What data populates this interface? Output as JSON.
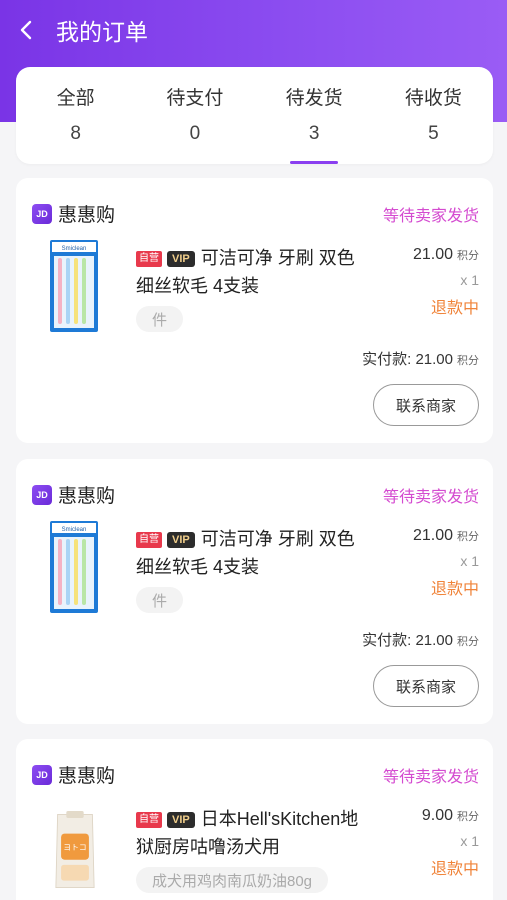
{
  "header": {
    "title": "我的订单",
    "back_icon": "chevron-left-icon"
  },
  "tabs": [
    {
      "label": "全部",
      "count": "8"
    },
    {
      "label": "待支付",
      "count": "0"
    },
    {
      "label": "待发货",
      "count": "3"
    },
    {
      "label": "待收货",
      "count": "5"
    }
  ],
  "active_tab": "待发货",
  "colors": {
    "accent": "#8a3ff0",
    "status": "#d44bd0",
    "refund": "#f0843a"
  },
  "orders": [
    {
      "shop": {
        "icon_text": "JD",
        "name": "惠惠购"
      },
      "status": "等待卖家发货",
      "product": {
        "tag_self": "自营",
        "tag_vip": "VIP",
        "title_line1": "可洁可净 牙刷 双色",
        "title_line2": "细丝软毛 4支装",
        "spec": "件",
        "thumb_brand": "Smiclean"
      },
      "price": "21.00",
      "price_unit": "积分",
      "qty": "x 1",
      "refund_status": "退款中",
      "paid_label": "实付款:",
      "paid_value": "21.00",
      "paid_unit": "积分",
      "contact_label": "联系商家"
    },
    {
      "shop": {
        "icon_text": "JD",
        "name": "惠惠购"
      },
      "status": "等待卖家发货",
      "product": {
        "tag_self": "自营",
        "tag_vip": "VIP",
        "title_line1": "可洁可净 牙刷 双色",
        "title_line2": "细丝软毛 4支装",
        "spec": "件",
        "thumb_brand": "Smiclean"
      },
      "price": "21.00",
      "price_unit": "积分",
      "qty": "x 1",
      "refund_status": "退款中",
      "paid_label": "实付款:",
      "paid_value": "21.00",
      "paid_unit": "积分",
      "contact_label": "联系商家"
    },
    {
      "shop": {
        "icon_text": "JD",
        "name": "惠惠购"
      },
      "status": "等待卖家发货",
      "product": {
        "tag_self": "自营",
        "tag_vip": "VIP",
        "title_line1": "日本Hell'sKitchen地",
        "title_line2": "狱厨房咕噜汤犬用",
        "spec": "成犬用鸡肉南瓜奶油80g",
        "thumb_brand": "ヨトコ"
      },
      "price": "9.00",
      "price_unit": "积分",
      "qty": "x 1",
      "refund_status": "退款中"
    }
  ]
}
